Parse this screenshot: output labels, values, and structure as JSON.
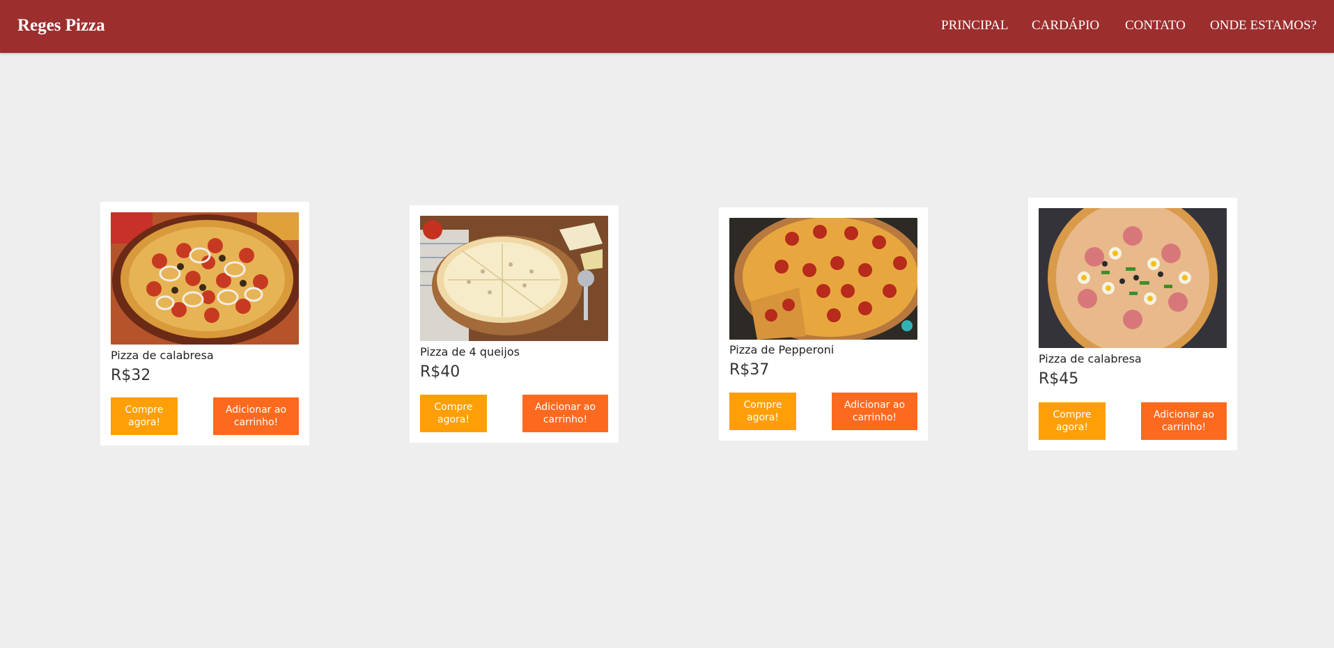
{
  "header": {
    "brand": "Reges Pizza",
    "nav": [
      "PRINCIPAL",
      "CARDÁPIO",
      "CONTATO",
      "ONDE ESTAMOS?"
    ],
    "background_color": "#9c2e2e"
  },
  "colors": {
    "page_background": "#eeeeee",
    "buy_button": "#fe9f08",
    "cart_button": "#fd6a1f"
  },
  "products": [
    {
      "name": "Pizza de calabresa",
      "price": "R$32",
      "buy_label": "Compre agora!",
      "cart_label": "Adicionar ao carrinho!",
      "image": "calabresa-pizza-image"
    },
    {
      "name": "Pizza de 4 queijos",
      "price": "R$40",
      "buy_label": "Compre agora!",
      "cart_label": "Adicionar ao carrinho!",
      "image": "four-cheese-pizza-image"
    },
    {
      "name": "Pizza de Pepperoni",
      "price": "R$37",
      "buy_label": "Compre agora!",
      "cart_label": "Adicionar ao carrinho!",
      "image": "pepperoni-pizza-image"
    },
    {
      "name": "Pizza de calabresa",
      "price": "R$45",
      "buy_label": "Compre agora!",
      "cart_label": "Adicionar ao carrinho!",
      "image": "mixed-pizza-image"
    }
  ]
}
